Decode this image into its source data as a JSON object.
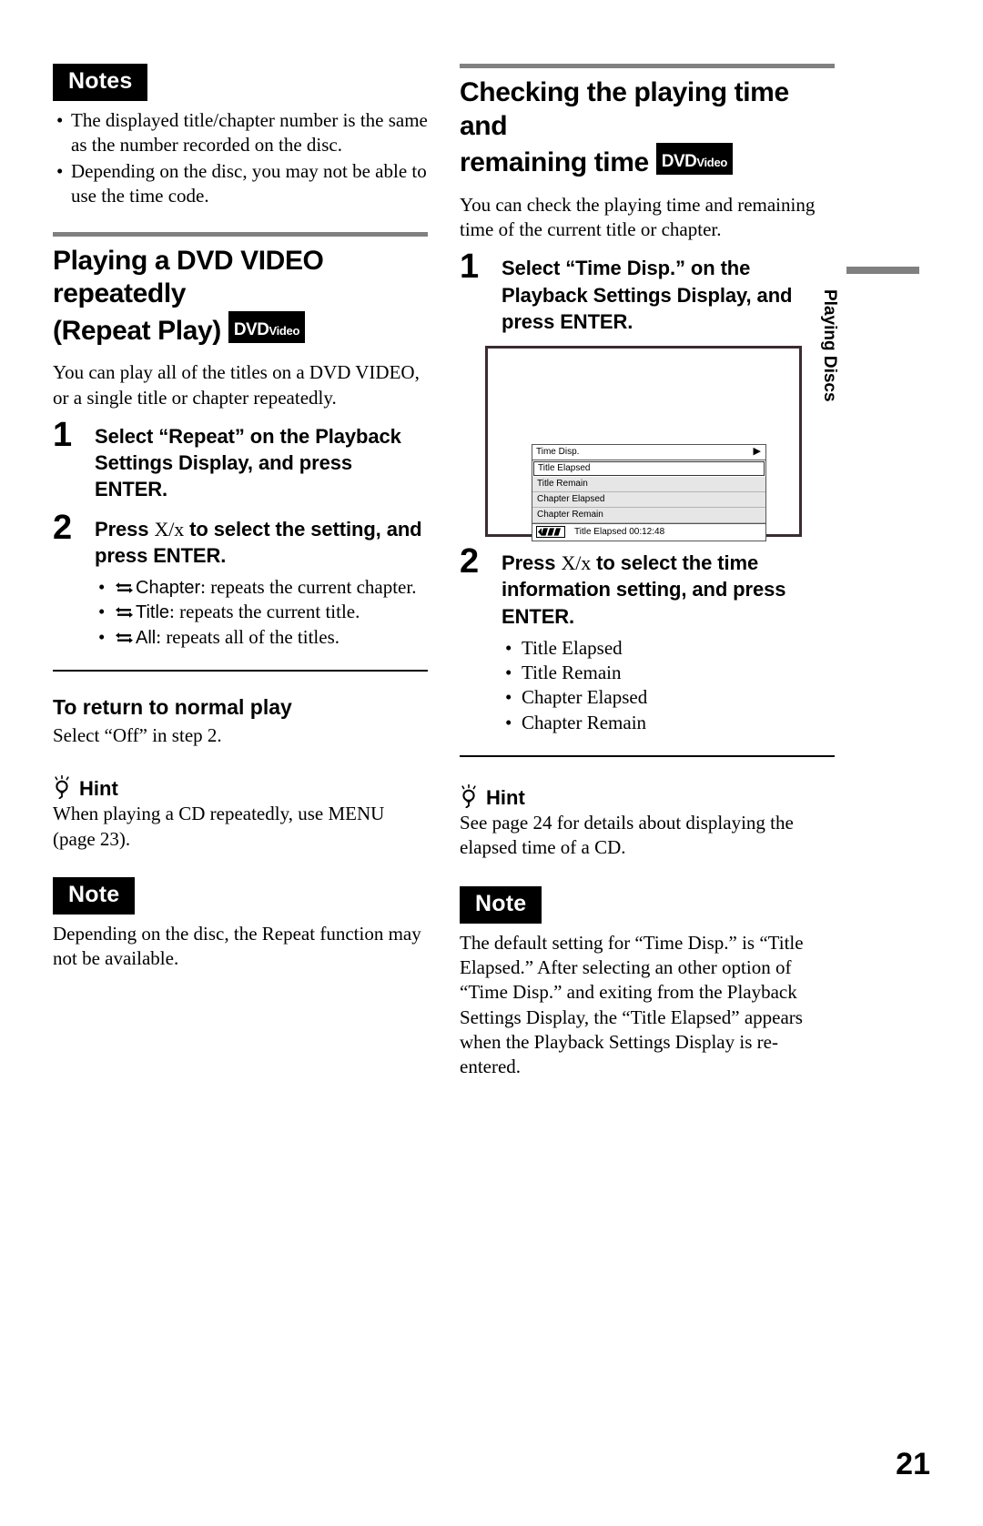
{
  "page": {
    "number": "21",
    "side_tab": "Playing Discs"
  },
  "left": {
    "notes_badge": "Notes",
    "notes_items": [
      "The displayed title/chapter number is the same as the number recorded on the disc.",
      "Depending on the disc, you may not be able to use the time code."
    ],
    "heading_line1": "Playing a DVD VIDEO repeatedly",
    "heading_line2": "(Repeat Play)",
    "dvd_logo": {
      "part1": "DVD",
      "part2": "Video"
    },
    "intro": "You can play all of the titles on a DVD VIDEO, or a single title or chapter repeatedly.",
    "step1": {
      "num": "1",
      "text_a": "Select “Repeat” on the Playback Settings Display, and press ENTER."
    },
    "step2": {
      "num": "2",
      "text_a": "Press ",
      "keys": "X/x",
      "text_b": " to select the setting, and press ENTER.",
      "options": [
        {
          "icon": "repeat-icon",
          "term": "Chapter",
          "desc": ": repeats the current chapter."
        },
        {
          "icon": "repeat-icon",
          "term": "Title",
          "desc": ": repeats the current title."
        },
        {
          "icon": "repeat-icon",
          "term": "All",
          "desc": ": repeats all of the titles."
        }
      ]
    },
    "subhead": "To return to normal play",
    "subhead_body": "Select “Off” in step 2.",
    "hint_label": "Hint",
    "hint_body": "When playing a CD repeatedly, use MENU (page 23).",
    "note_badge": "Note",
    "note_body": "Depending on the disc, the Repeat function may not be available."
  },
  "right": {
    "heading_line1": "Checking the playing time and",
    "heading_line2": "remaining time",
    "dvd_logo": {
      "part1": "DVD",
      "part2": "Video"
    },
    "intro": "You can check the playing time and remaining time of the current title or chapter.",
    "step1": {
      "num": "1",
      "text_a": "Select “Time Disp.” on the Playback Settings Display, and press ENTER."
    },
    "screen": {
      "osd_title": "Time Disp.",
      "play_arrow": "▶",
      "rows": [
        {
          "label": "Title Elapsed",
          "selected": true
        },
        {
          "label": "Title Remain",
          "selected": false
        },
        {
          "label": "Chapter Elapsed",
          "selected": false
        },
        {
          "label": "Chapter Remain",
          "selected": false
        }
      ],
      "status_text": "Title Elapsed 00:12:48"
    },
    "step2": {
      "num": "2",
      "text_a": "Press ",
      "keys": "X/x",
      "text_b": " to select the time information setting, and press ENTER.",
      "options": [
        "Title Elapsed",
        "Title Remain",
        "Chapter Elapsed",
        "Chapter Remain"
      ]
    },
    "hint_label": "Hint",
    "hint_body": "See page 24 for details about displaying the elapsed time of a CD.",
    "note_badge": "Note",
    "note_body": "The default setting for “Time Disp.” is “Title Elapsed.” After selecting an other option of “Time Disp.” and exiting from the Playback Settings Display, the “Title Elapsed” appears when the Playback Settings Display is re-entered."
  }
}
